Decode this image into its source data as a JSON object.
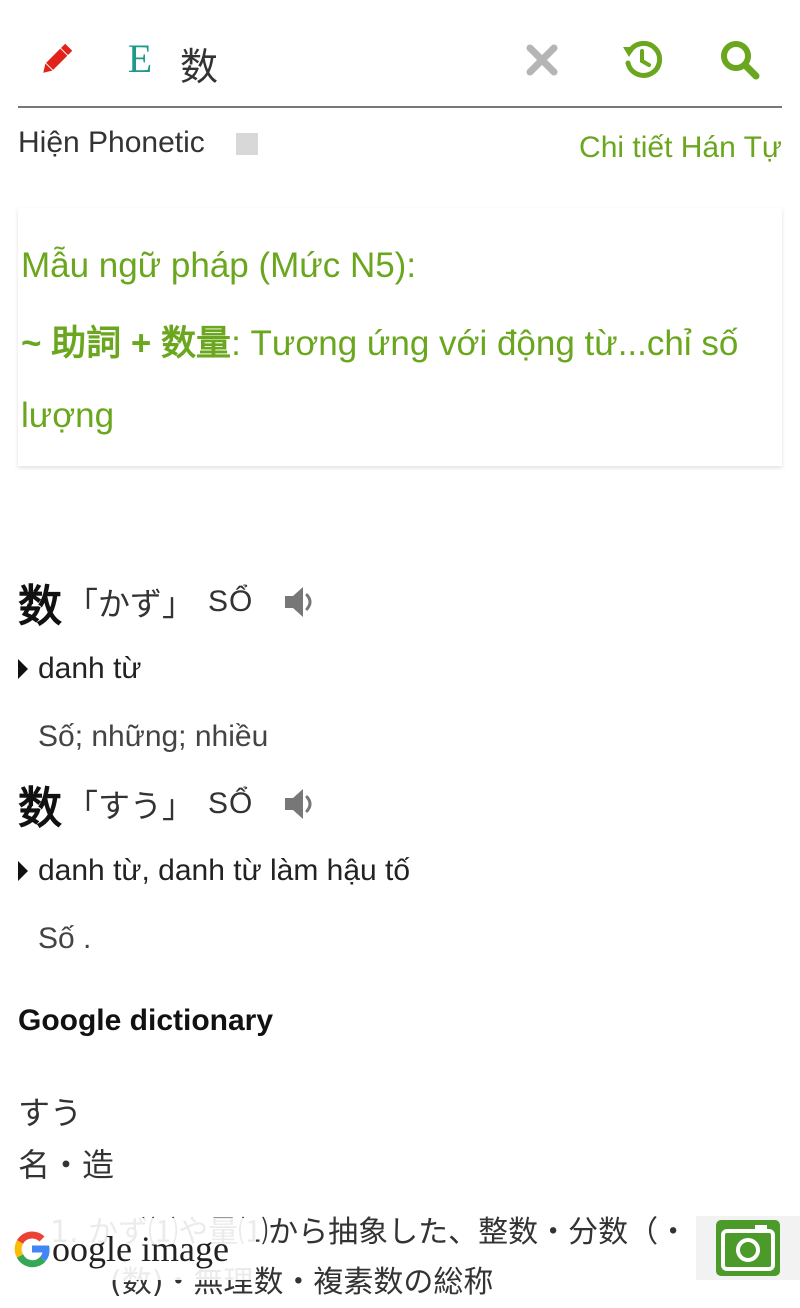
{
  "toolbar": {
    "lang_label": "E",
    "query": "数"
  },
  "phonetic": {
    "label": "Hiện Phonetic",
    "detail_link": "Chi tiết Hán Tự"
  },
  "grammar": {
    "title": "Mẫu ngữ pháp (Mức N5):",
    "item_bold": " ~ 助詞 + 数量",
    "item_text": ": Tương ứng với động từ...chỉ số lượng"
  },
  "entries": [
    {
      "kanji": "数",
      "reading": "「かず」",
      "hanviet": "SỔ",
      "pos": "danh từ",
      "meaning": "Số; những; nhiều"
    },
    {
      "kanji": "数",
      "reading": "「すう」",
      "hanviet": "SỔ",
      "pos": "danh từ, danh từ làm hậu tố",
      "meaning": "Số ."
    }
  ],
  "google_dictionary": {
    "title": "Google dictionary",
    "reading": "すう",
    "pos": "名・造",
    "def_line1": "1. かず⑴や量⑴から抽象した、整数・分数（・ト",
    "def_line2": "　　(数)・無理数・複素数の総称"
  },
  "bottom": {
    "google_image_label": "oogle image"
  },
  "colors": {
    "accent": "#6aa61e",
    "edit_icon": "#e2231a",
    "lang_icon": "#1f9a8a",
    "camera_icon": "#4c9a2a"
  },
  "icons": {
    "edit": "pencil-icon",
    "clear": "close-icon",
    "history": "history-icon",
    "search": "search-icon",
    "speaker": "speaker-icon",
    "camera": "camera-icon",
    "google": "google-g-icon"
  }
}
